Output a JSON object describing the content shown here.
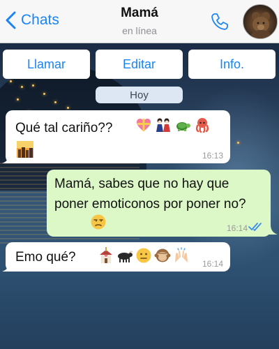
{
  "header": {
    "back_label": "Chats",
    "title": "Mamá",
    "subtitle": "en línea"
  },
  "actions": {
    "call": "Llamar",
    "edit": "Editar",
    "info": "Info."
  },
  "date_label": "Hoy",
  "messages": [
    {
      "direction": "incoming",
      "text": "Qué tal cariño??",
      "emojis": [
        "gift-heart-emoji",
        "dolls-emoji",
        "turtle-emoji",
        "octopus-emoji",
        "sunset-city-emoji"
      ],
      "time": "16:13"
    },
    {
      "direction": "outgoing",
      "text": "Mamá, sabes que no hay que poner emoticonos por poner no?",
      "emojis": [
        "unamused-face-emoji"
      ],
      "time": "16:14",
      "read": true
    },
    {
      "direction": "incoming",
      "text": "Emo qué?",
      "emojis": [
        "wedding-chapel-emoji",
        "ox-emoji",
        "neutral-face-emoji",
        "see-no-evil-monkey-emoji",
        "raised-hands-emoji"
      ],
      "time": "16:14"
    }
  ],
  "colors": {
    "accent": "#1a84f5",
    "outgoing_bubble": "#dcf8c6",
    "incoming_bubble": "#ffffff",
    "read_ticks": "#3b8cf0"
  }
}
